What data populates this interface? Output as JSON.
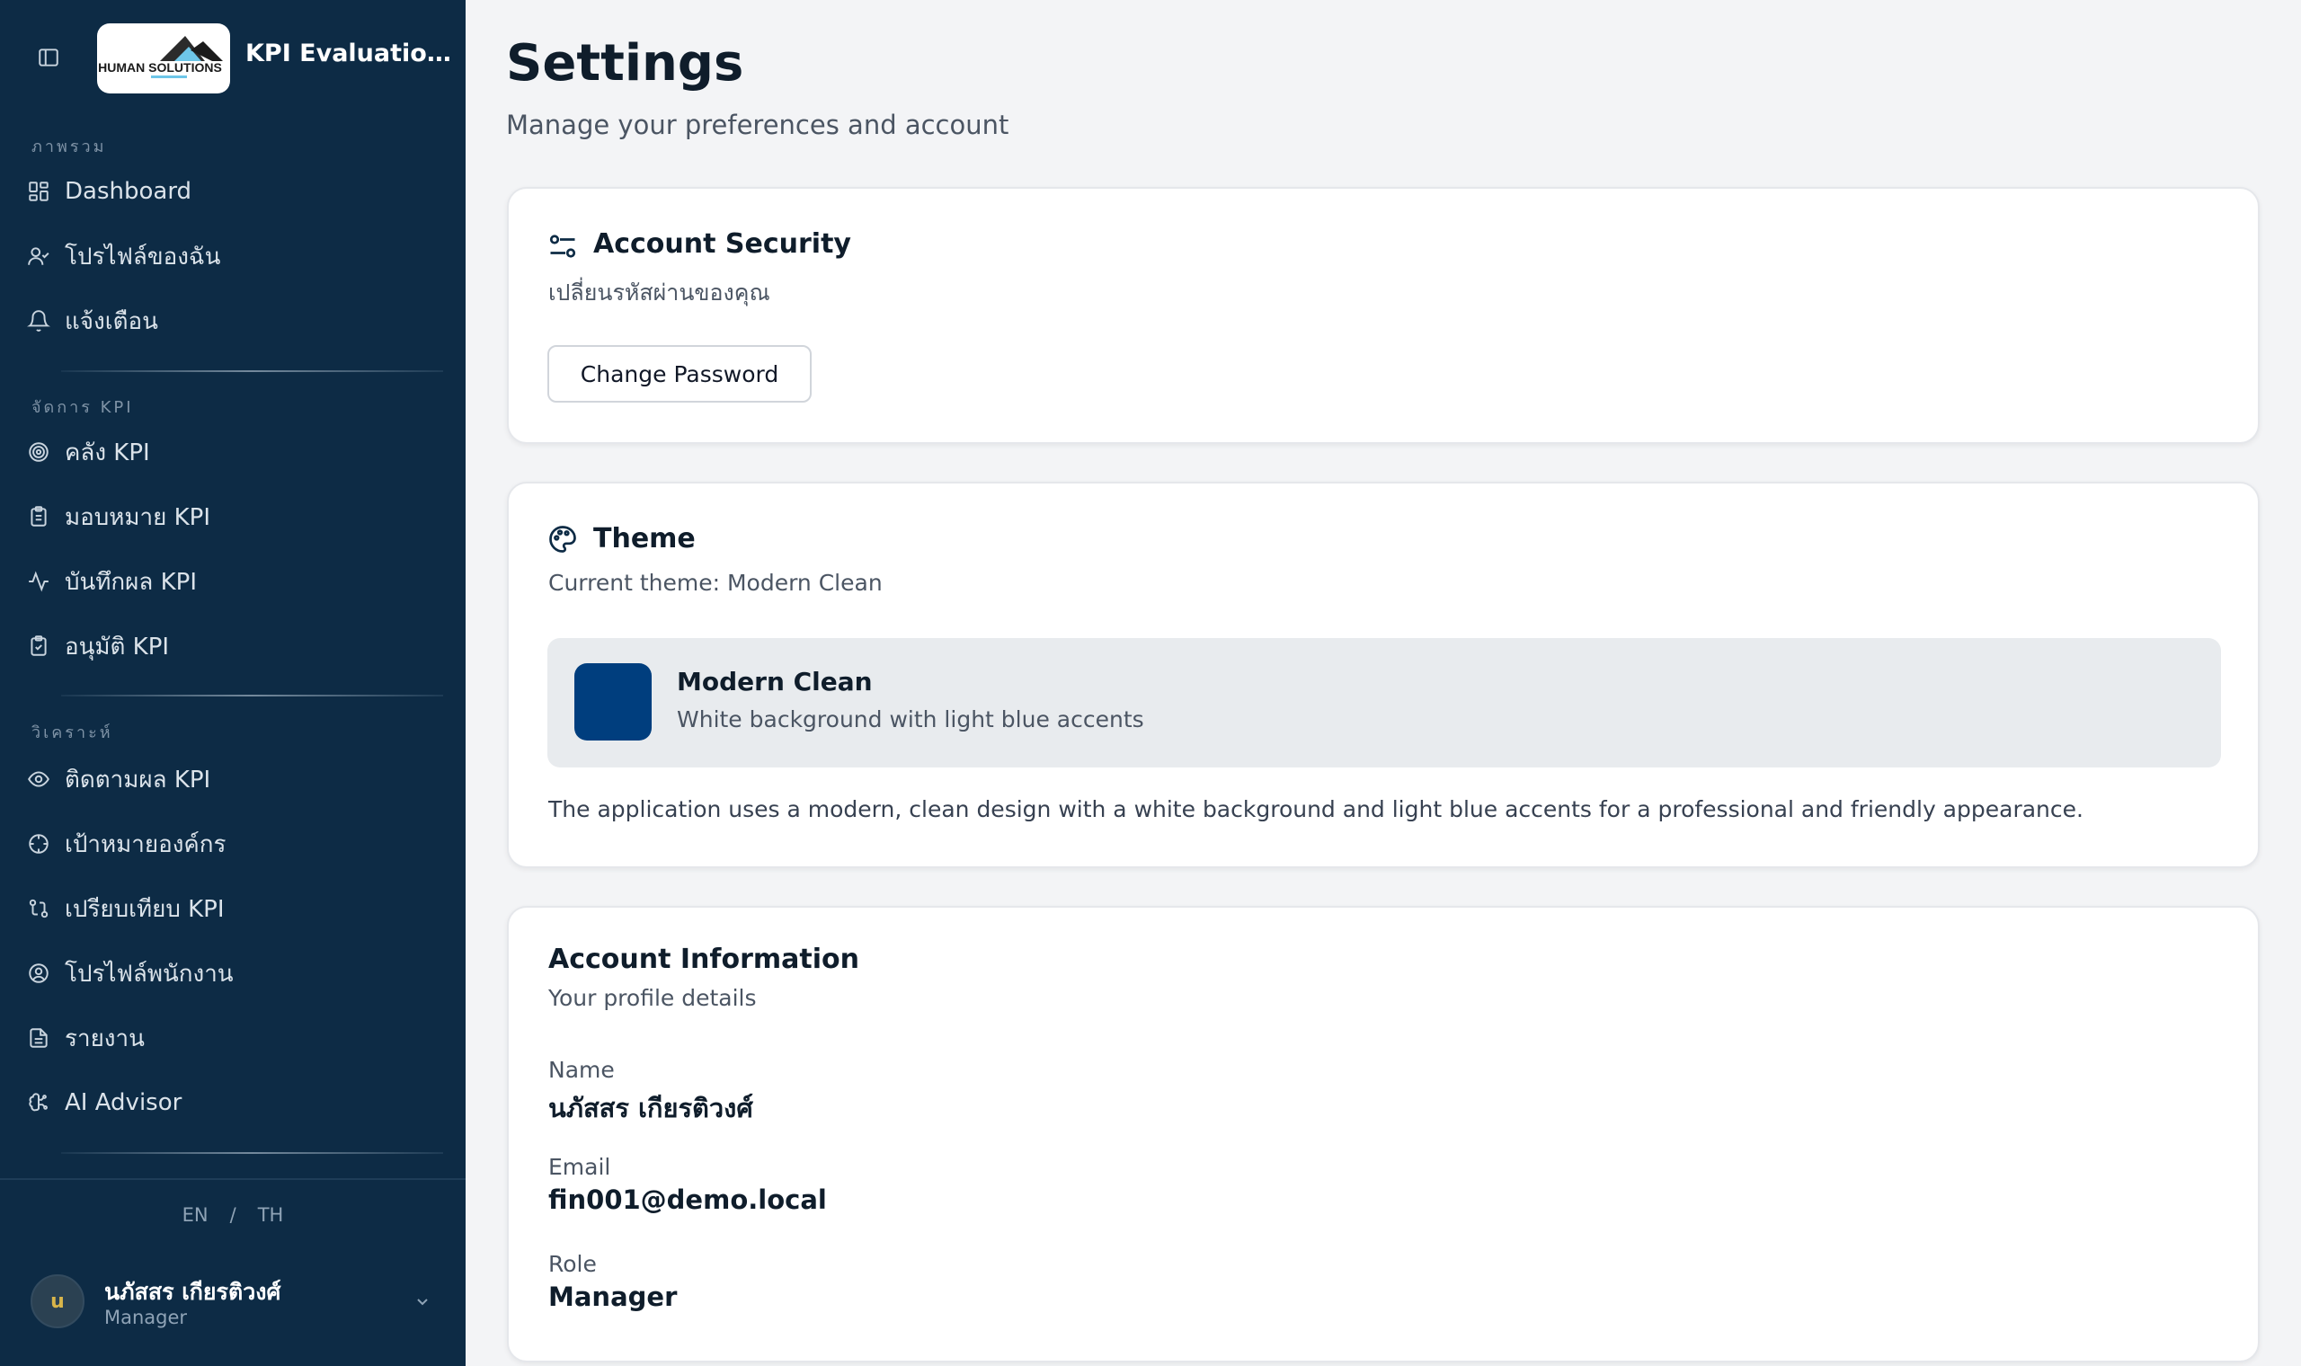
{
  "sidebar": {
    "app_title": "KPI Evaluation System",
    "logo_text": "HUMAN SOLUTIONS",
    "sections": [
      {
        "label": "ภาพรวม",
        "items": [
          {
            "label": "Dashboard",
            "icon": "layout-grid-icon"
          },
          {
            "label": "โปรไฟล์ของฉัน",
            "icon": "user-check-icon"
          },
          {
            "label": "แจ้งเตือน",
            "icon": "bell-icon"
          }
        ]
      },
      {
        "label": "จัดการ KPI",
        "items": [
          {
            "label": "คลัง KPI",
            "icon": "target-icon"
          },
          {
            "label": "มอบหมาย KPI",
            "icon": "clipboard-list-icon"
          },
          {
            "label": "บันทึกผล KPI",
            "icon": "activity-icon"
          },
          {
            "label": "อนุมัติ KPI",
            "icon": "clipboard-check-icon"
          }
        ]
      },
      {
        "label": "วิเคราะห์",
        "items": [
          {
            "label": "ติดตามผล KPI",
            "icon": "eye-icon"
          },
          {
            "label": "เป้าหมายองค์กร",
            "icon": "crosshair-icon"
          },
          {
            "label": "เปรียบเทียบ KPI",
            "icon": "git-compare-icon"
          },
          {
            "label": "โปรไฟล์พนักงาน",
            "icon": "user-circle-icon"
          },
          {
            "label": "รายงาน",
            "icon": "file-text-icon"
          },
          {
            "label": "AI Advisor",
            "icon": "brain-icon"
          }
        ]
      }
    ],
    "lang": {
      "en": "EN",
      "sep": "/",
      "th": "TH"
    },
    "user": {
      "initial": "u",
      "name": "นภัสสร เกียรติวงศ์",
      "role": "Manager"
    }
  },
  "page": {
    "title": "Settings",
    "subtitle": "Manage your preferences and account"
  },
  "security": {
    "title": "Account Security",
    "desc": "เปลี่ยนรหัสผ่านของคุณ",
    "button": "Change Password"
  },
  "theme": {
    "title": "Theme",
    "current": "Current theme: Modern Clean",
    "option_name": "Modern Clean",
    "option_desc": "White background with light blue accents",
    "note": "The application uses a modern, clean design with a white background and light blue accents for a professional and friendly appearance.",
    "swatch_color": "#003e7e"
  },
  "account": {
    "title": "Account Information",
    "desc": "Your profile details",
    "name_label": "Name",
    "name_value": "นภัสสร เกียรติวงศ์",
    "email_label": "Email",
    "email_value": "fin001@demo.local",
    "role_label": "Role",
    "role_value": "Manager"
  },
  "colors": {
    "sidebar_bg": "#0d2b45",
    "icon_accent": "#0d2b45"
  }
}
